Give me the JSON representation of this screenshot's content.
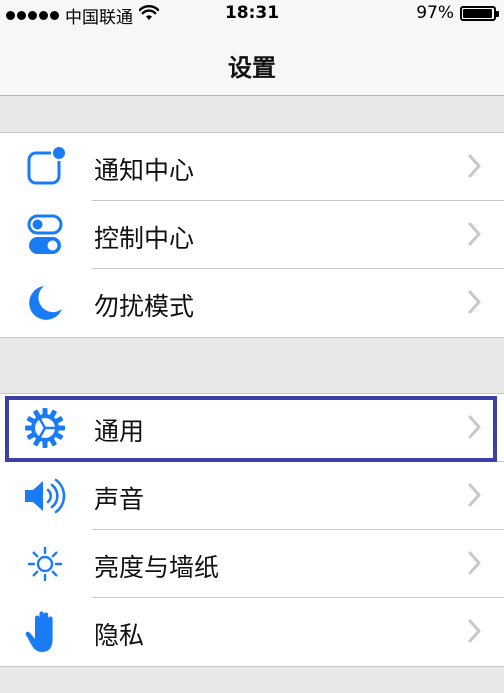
{
  "status_bar": {
    "carrier": "中国联通",
    "time": "18:31",
    "battery_percent": "97%",
    "battery_level": 0.97,
    "signal_icon": "signal-dots-icon",
    "wifi_icon": "wifi-icon"
  },
  "nav": {
    "title": "设置"
  },
  "groups": [
    {
      "items": [
        {
          "label": "通知中心",
          "icon": "notification-center-icon"
        },
        {
          "label": "控制中心",
          "icon": "control-center-icon"
        },
        {
          "label": "勿扰模式",
          "icon": "moon-icon"
        }
      ]
    },
    {
      "items": [
        {
          "label": "通用",
          "icon": "gear-icon",
          "highlighted": true
        },
        {
          "label": "声音",
          "icon": "speaker-icon"
        },
        {
          "label": "亮度与墙纸",
          "icon": "sun-icon"
        },
        {
          "label": "隐私",
          "icon": "hand-icon"
        }
      ]
    }
  ],
  "accent_color": "#1a7cf5",
  "highlight_color": "#3b3fa8"
}
